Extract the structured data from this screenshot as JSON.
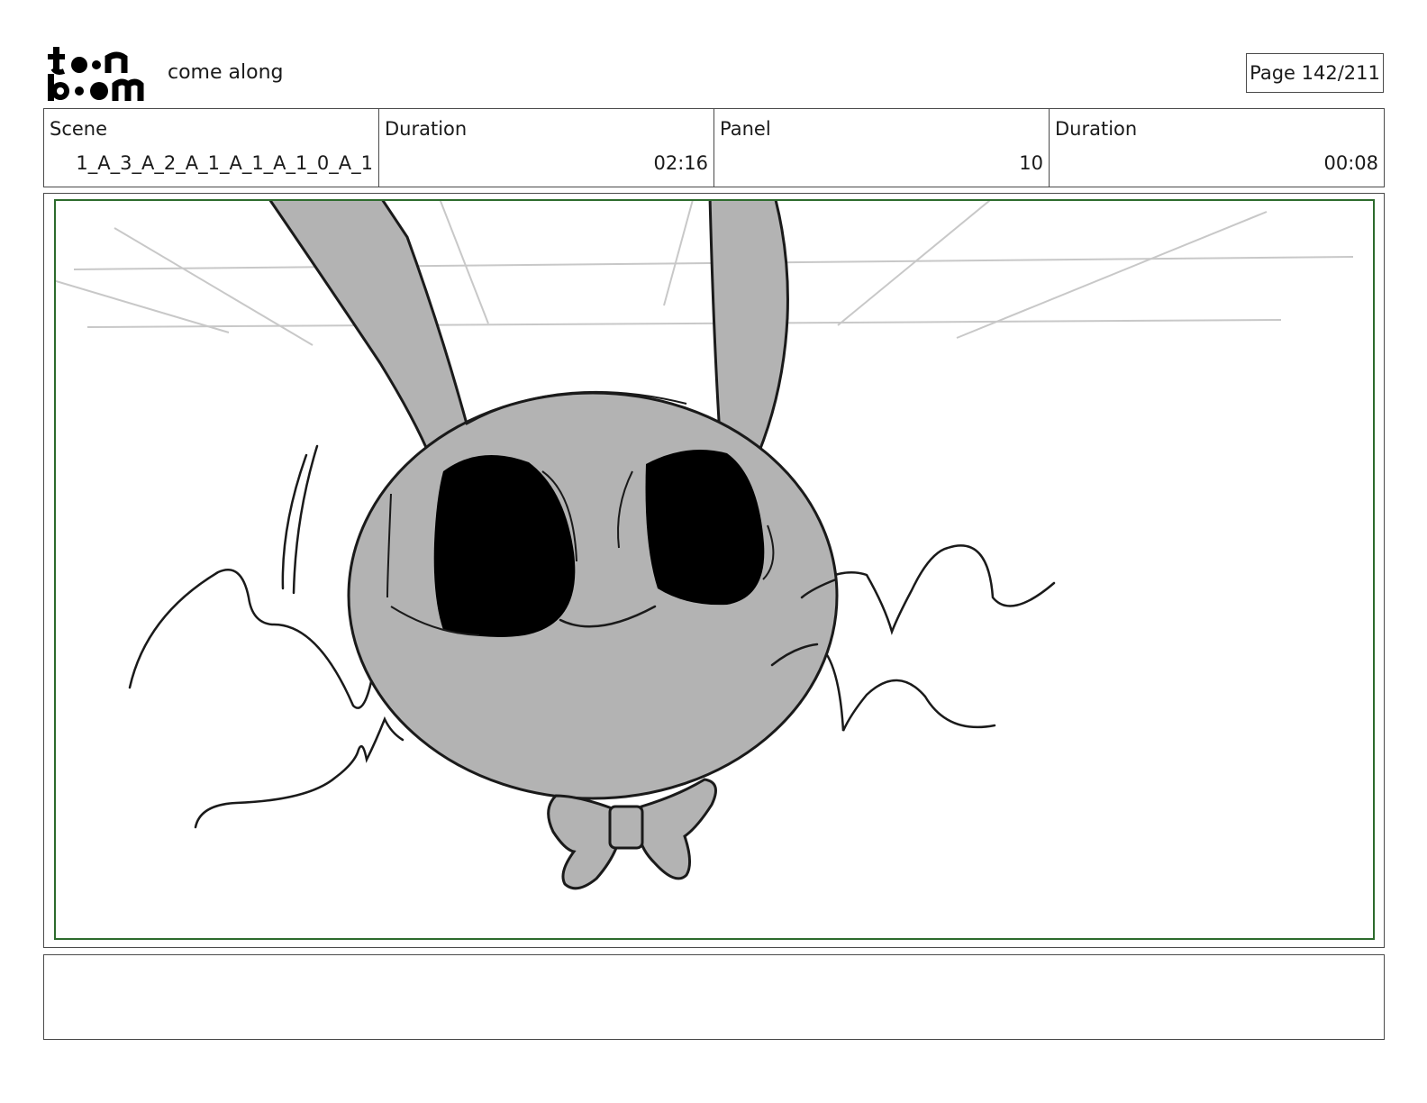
{
  "header": {
    "logo_text": "toon boom",
    "project_title": "come along",
    "page_label": "Page 142/211"
  },
  "info": {
    "scene_label": "Scene",
    "scene_value": "1_A_3_A_2_A_1_A_1_A_1_0_A_1",
    "scene_duration_label": "Duration",
    "scene_duration_value": "02:16",
    "panel_label": "Panel",
    "panel_value": "10",
    "panel_duration_label": "Duration",
    "panel_duration_value": "00:08"
  },
  "colors": {
    "safe_area_border": "#2d6b2d",
    "character_fill": "#b3b3b3",
    "line_art": "#1a1a1a",
    "background_lines": "#c8c8c8"
  },
  "notes": ""
}
